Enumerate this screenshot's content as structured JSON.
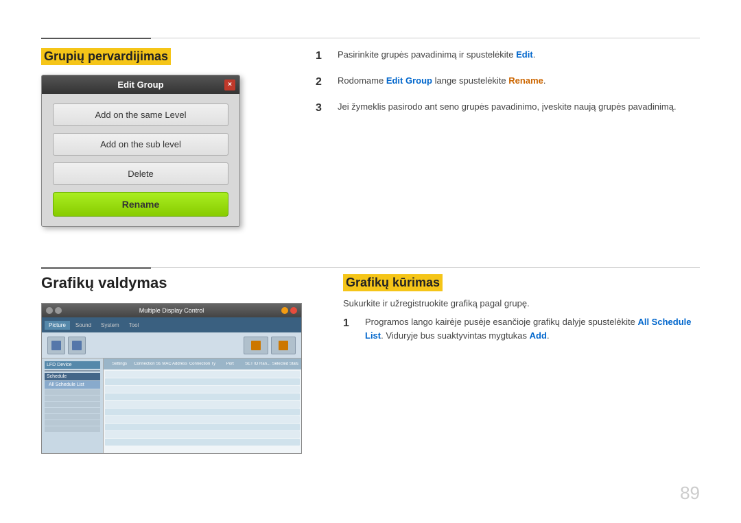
{
  "page": {
    "number": "89"
  },
  "section1": {
    "title": "Grupių pervardijimas",
    "dialog": {
      "title": "Edit Group",
      "buttons": [
        "Add on the same Level",
        "Add on the sub level",
        "Delete"
      ],
      "rename_btn": "Rename",
      "close_icon": "×"
    },
    "steps": [
      {
        "num": "1",
        "text_before": "Pasirinkite grupės pavadinimą ir spustelėkite ",
        "link1": "Edit",
        "link1_color": "blue",
        "text_after": "."
      },
      {
        "num": "2",
        "text_before": "Rodomame ",
        "link1": "Edit Group",
        "link1_color": "blue",
        "text_middle": " lange spustelėkite ",
        "link2": "Rename",
        "link2_color": "orange",
        "text_after": "."
      },
      {
        "num": "3",
        "text": "Jei žymeklis pasirodo ant seno grupės pavadinimo, įveskite naują grupės pavadinimą."
      }
    ]
  },
  "section2": {
    "title": "Grafikų valdymas",
    "screenshot": {
      "titlebar": "Multiple Display Control",
      "nav_items": [
        "Picture",
        "Sound",
        "System",
        "Tool"
      ],
      "sidebar_items": [
        "LFD Device",
        "Schedule"
      ],
      "sidebar_sub": "All Schedule List",
      "table_headers": [
        "Settings",
        "Connection Status",
        "MAC Address",
        "Connection Type",
        "Port",
        "SET ID Ran...",
        "Selected Status"
      ]
    }
  },
  "section3": {
    "title": "Grafikų kūrimas",
    "sub_text": "Sukurkite ir užregistruokite grafiką pagal grupę.",
    "steps": [
      {
        "num": "1",
        "text_before": "Programos lango kairėje pusėje esančioje grafikų dalyje spustelėkite ",
        "link1": "All Schedule List",
        "link1_color": "blue",
        "text_middle": ". Viduryje bus suaktyvintas mygtukas ",
        "link2": "Add",
        "link2_color": "blue",
        "text_after": "."
      }
    ]
  }
}
